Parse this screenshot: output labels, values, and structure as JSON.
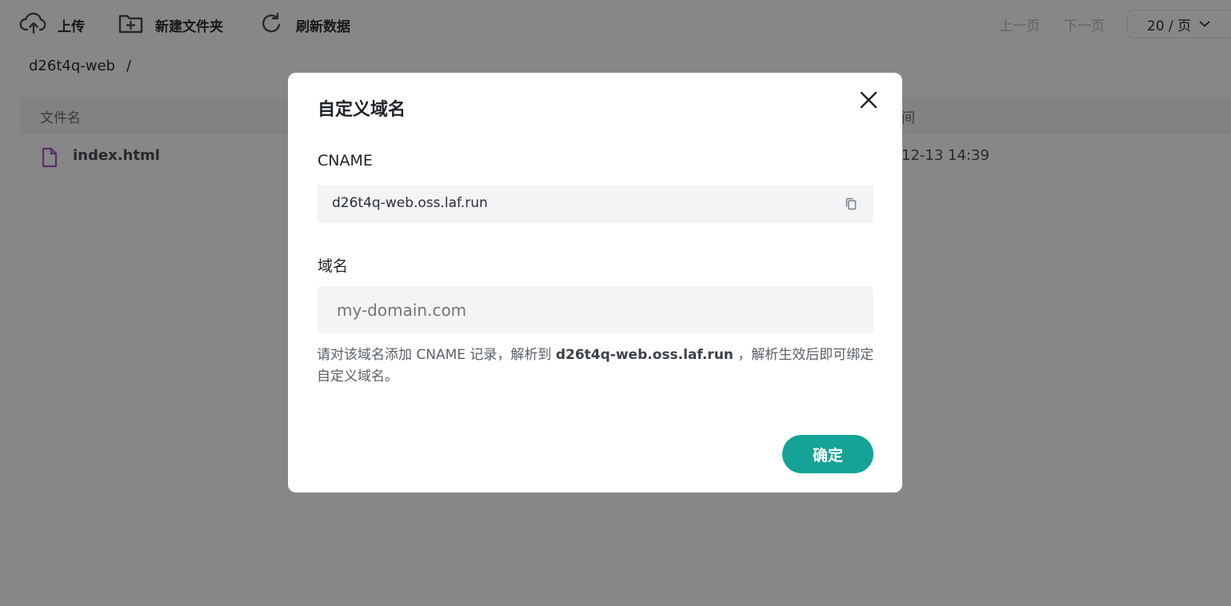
{
  "toolbar": {
    "upload_label": "上传",
    "new_folder_label": "新建文件夹",
    "refresh_label": "刷新数据"
  },
  "pagination": {
    "prev_label": "上一页",
    "next_label": "下一页",
    "page_size": "20 / 页"
  },
  "breadcrumb": {
    "bucket": "d26t4q-web",
    "separator": "/"
  },
  "table": {
    "headers": {
      "name": "文件名",
      "time": "间"
    },
    "rows": [
      {
        "name": "index.html",
        "time": "12-13 14:39"
      }
    ]
  },
  "modal": {
    "title": "自定义域名",
    "cname_label": "CNAME",
    "cname_value": "d26t4q-web.oss.laf.run",
    "domain_label": "域名",
    "domain_placeholder": "my-domain.com",
    "domain_value": "",
    "hint_prefix": "请对该域名添加 CNAME 记录，解析到 ",
    "hint_target": "d26t4q-web.oss.laf.run",
    "hint_suffix": " ，解析生效后即可绑定自定义域名。",
    "confirm_label": "确定"
  },
  "colors": {
    "accent": "#14a396",
    "file_icon": "#a35bc7",
    "overlay": "rgba(0,0,0,0.47)"
  },
  "icons": {
    "upload": "cloud-upload-icon",
    "new_folder": "folder-plus-icon",
    "refresh": "refresh-icon",
    "file": "file-icon",
    "close": "close-icon",
    "copy": "copy-icon",
    "dropdown": "chevron-down-icon"
  }
}
